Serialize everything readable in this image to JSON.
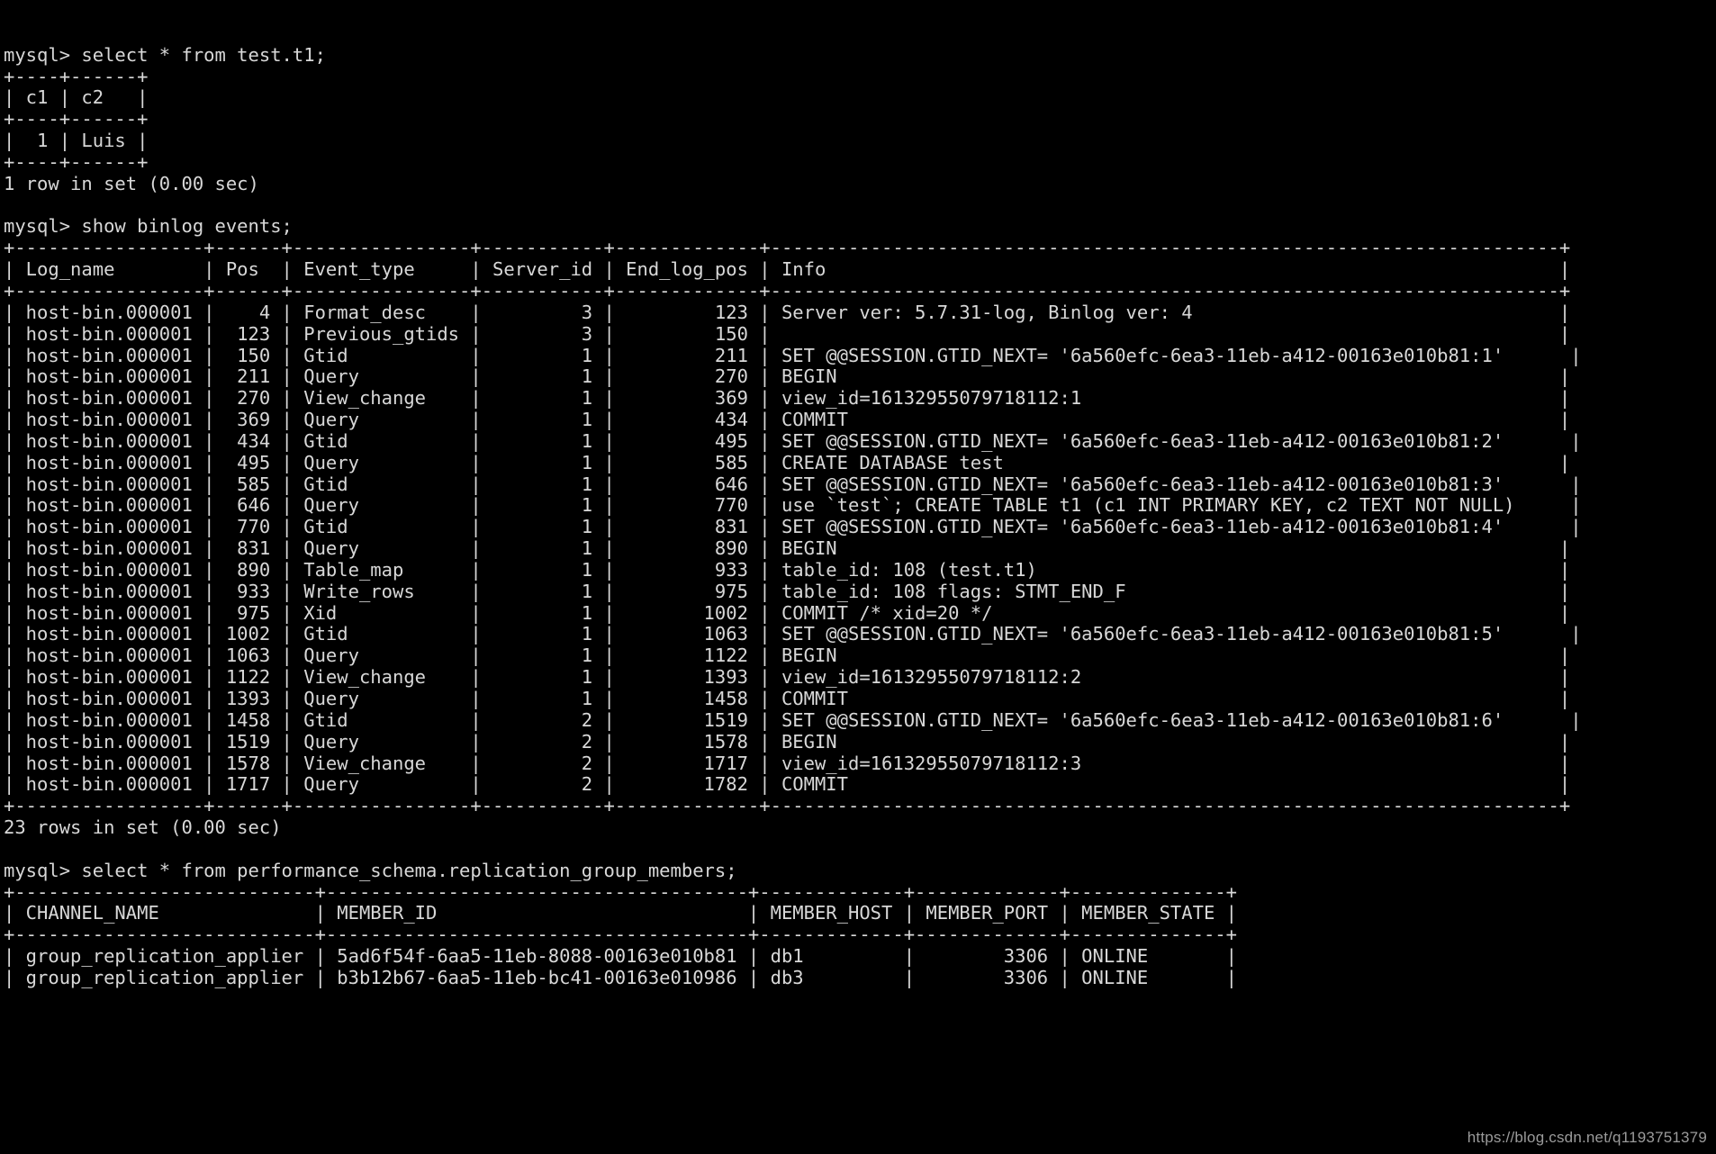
{
  "terminal": {
    "prompt": "mysql> ",
    "watermark": "https://blog.csdn.net/q1193751379",
    "background_color": "#000000",
    "text_color": "#d8d8d8"
  },
  "session": {
    "blocks": [
      {
        "command": "mysql> select * from test.t1;",
        "table": {
          "separator": "+----+------+",
          "header": "| c1 | c2   |",
          "rows": [
            "|  1 | Luis |"
          ]
        },
        "result": "1 row in set (0.00 sec)"
      },
      {
        "command": "mysql> show binlog events;",
        "table": {
          "separator": "+---------------+------+----------------+-----------+-------------+-------------------------------------------------------------------------+",
          "header": "| Log_name      | Pos  | Event_type     | Server_id | End_log_pos | Info                                                                    |",
          "rows": [
            "| host-bin.000001 |    4 | Format_desc    |         3 |         123 | Server ver: 5.7.31-log, Binlog ver: 4",
            "| host-bin.000001 |  123 | Previous_gtids |         3 |         150 |"
          ]
        },
        "result": "23 rows in set (0.00 sec)"
      },
      {
        "command": "mysql> select * from performance_schema.replication_group_members;",
        "table": {
          "separator": "+---------------------------+--------------------------------------+-------------+-------------+--------------+",
          "header": "| CHANNEL_NAME              | MEMBER_ID                            | MEMBER_HOST | MEMBER_PORT | MEMBER_STATE |"
        }
      }
    ]
  },
  "binlog_query": {
    "command": "mysql> show binlog events;",
    "columns": [
      "Log_name",
      "Pos",
      "Event_type",
      "Server_id",
      "End_log_pos",
      "Info"
    ],
    "rows": [
      [
        "host-bin.000001",
        "4",
        "Format_desc",
        "3",
        "123",
        "Server ver: 5.7.31-log, Binlog ver: 4"
      ],
      [
        "host-bin.000001",
        "123",
        "Previous_gtids",
        "3",
        "150",
        ""
      ],
      [
        "host-bin.000001",
        "150",
        "Gtid",
        "1",
        "211",
        "SET @@SESSION.GTID_NEXT= '6a560efc-6ea3-11eb-a412-00163e010b81:1'"
      ],
      [
        "host-bin.000001",
        "211",
        "Query",
        "1",
        "270",
        "BEGIN"
      ],
      [
        "host-bin.000001",
        "270",
        "View_change",
        "1",
        "369",
        "view_id=16132955079718112:1"
      ],
      [
        "host-bin.000001",
        "369",
        "Query",
        "1",
        "434",
        "COMMIT"
      ],
      [
        "host-bin.000001",
        "434",
        "Gtid",
        "1",
        "495",
        "SET @@SESSION.GTID_NEXT= '6a560efc-6ea3-11eb-a412-00163e010b81:2'"
      ],
      [
        "host-bin.000001",
        "495",
        "Query",
        "1",
        "585",
        "CREATE DATABASE test"
      ],
      [
        "host-bin.000001",
        "585",
        "Gtid",
        "1",
        "646",
        "SET @@SESSION.GTID_NEXT= '6a560efc-6ea3-11eb-a412-00163e010b81:3'"
      ],
      [
        "host-bin.000001",
        "646",
        "Query",
        "1",
        "770",
        "use `test`; CREATE TABLE t1 (c1 INT PRIMARY KEY, c2 TEXT NOT NULL)"
      ],
      [
        "host-bin.000001",
        "770",
        "Gtid",
        "1",
        "831",
        "SET @@SESSION.GTID_NEXT= '6a560efc-6ea3-11eb-a412-00163e010b81:4'"
      ],
      [
        "host-bin.000001",
        "831",
        "Query",
        "1",
        "890",
        "BEGIN"
      ],
      [
        "host-bin.000001",
        "890",
        "Table_map",
        "1",
        "933",
        "table_id: 108 (test.t1)"
      ],
      [
        "host-bin.000001",
        "933",
        "Write_rows",
        "1",
        "975",
        "table_id: 108 flags: STMT_END_F"
      ],
      [
        "host-bin.000001",
        "975",
        "Xid",
        "1",
        "1002",
        "COMMIT /* xid=20 */"
      ],
      [
        "host-bin.000001",
        "1002",
        "Gtid",
        "1",
        "1063",
        "SET @@SESSION.GTID_NEXT= '6a560efc-6ea3-11eb-a412-00163e010b81:5'"
      ],
      [
        "host-bin.000001",
        "1063",
        "Query",
        "1",
        "1122",
        "BEGIN"
      ],
      [
        "host-bin.000001",
        "1122",
        "View_change",
        "1",
        "1393",
        "view_id=16132955079718112:2"
      ],
      [
        "host-bin.000001",
        "1393",
        "Query",
        "1",
        "1458",
        "COMMIT"
      ],
      [
        "host-bin.000001",
        "1458",
        "Gtid",
        "2",
        "1519",
        "SET @@SESSION.GTID_NEXT= '6a560efc-6ea3-11eb-a412-00163e010b81:6'"
      ],
      [
        "host-bin.000001",
        "1519",
        "Query",
        "2",
        "1578",
        "BEGIN"
      ],
      [
        "host-bin.000001",
        "1578",
        "View_change",
        "2",
        "1717",
        "view_id=16132955079718112:3"
      ],
      [
        "host-bin.000001",
        "1717",
        "Query",
        "2",
        "1782",
        "COMMIT"
      ]
    ],
    "result": "23 rows in set (0.00 sec)"
  },
  "select_t1": {
    "command": "mysql> select * from test.t1;",
    "columns": [
      "c1",
      "c2"
    ],
    "rows": [
      [
        "1",
        "Luis"
      ]
    ],
    "result": "1 row in set (0.00 sec)"
  },
  "members_query": {
    "command": "mysql> select * from performance_schema.replication_group_members;",
    "columns": [
      "CHANNEL_NAME",
      "MEMBER_ID",
      "MEMBER_HOST",
      "MEMBER_PORT",
      "MEMBER_STATE"
    ],
    "rows": [
      [
        "group_replication_applier",
        "5ad6f54f-6aa5-11eb-8088-00163e010b81",
        "db1",
        "3306",
        "ONLINE"
      ],
      [
        "group_replication_applier",
        "b3b12b67-6aa5-11eb-bc41-00163e010986",
        "db3",
        "3306",
        "ONLINE"
      ]
    ]
  },
  "rendered_lines": [
    "mysql> select * from test.t1;",
    "+----+------+",
    "| c1 | c2   |",
    "+----+------+",
    "|  1 | Luis |",
    "+----+------+",
    "1 row in set (0.00 sec)",
    "",
    "mysql> show binlog events;",
    "+-----------------+------+----------------+-----------+-------------+-----------------------------------------------------------------------+",
    "| Log_name        | Pos  | Event_type     | Server_id | End_log_pos | Info                                                                  |",
    "+-----------------+------+----------------+-----------+-------------+-----------------------------------------------------------------------+",
    "| host-bin.000001 |    4 | Format_desc    |         3 |         123 | Server ver: 5.7.31-log, Binlog ver: 4                                 |",
    "| host-bin.000001 |  123 | Previous_gtids |         3 |         150 |                                                                       |",
    "| host-bin.000001 |  150 | Gtid           |         1 |         211 | SET @@SESSION.GTID_NEXT= '6a560efc-6ea3-11eb-a412-00163e010b81:1'      |",
    "| host-bin.000001 |  211 | Query          |         1 |         270 | BEGIN                                                                 |",
    "| host-bin.000001 |  270 | View_change    |         1 |         369 | view_id=16132955079718112:1                                           |",
    "| host-bin.000001 |  369 | Query          |         1 |         434 | COMMIT                                                                |",
    "| host-bin.000001 |  434 | Gtid           |         1 |         495 | SET @@SESSION.GTID_NEXT= '6a560efc-6ea3-11eb-a412-00163e010b81:2'      |",
    "| host-bin.000001 |  495 | Query          |         1 |         585 | CREATE DATABASE test                                                  |",
    "| host-bin.000001 |  585 | Gtid           |         1 |         646 | SET @@SESSION.GTID_NEXT= '6a560efc-6ea3-11eb-a412-00163e010b81:3'      |",
    "| host-bin.000001 |  646 | Query          |         1 |         770 | use `test`; CREATE TABLE t1 (c1 INT PRIMARY KEY, c2 TEXT NOT NULL)     |",
    "| host-bin.000001 |  770 | Gtid           |         1 |         831 | SET @@SESSION.GTID_NEXT= '6a560efc-6ea3-11eb-a412-00163e010b81:4'      |",
    "| host-bin.000001 |  831 | Query          |         1 |         890 | BEGIN                                                                 |",
    "| host-bin.000001 |  890 | Table_map      |         1 |         933 | table_id: 108 (test.t1)                                               |",
    "| host-bin.000001 |  933 | Write_rows     |         1 |         975 | table_id: 108 flags: STMT_END_F                                       |",
    "| host-bin.000001 |  975 | Xid            |         1 |        1002 | COMMIT /* xid=20 */                                                   |",
    "| host-bin.000001 | 1002 | Gtid           |         1 |        1063 | SET @@SESSION.GTID_NEXT= '6a560efc-6ea3-11eb-a412-00163e010b81:5'      |",
    "| host-bin.000001 | 1063 | Query          |         1 |        1122 | BEGIN                                                                 |",
    "| host-bin.000001 | 1122 | View_change    |         1 |        1393 | view_id=16132955079718112:2                                           |",
    "| host-bin.000001 | 1393 | Query          |         1 |        1458 | COMMIT                                                                |",
    "| host-bin.000001 | 1458 | Gtid           |         2 |        1519 | SET @@SESSION.GTID_NEXT= '6a560efc-6ea3-11eb-a412-00163e010b81:6'      |",
    "| host-bin.000001 | 1519 | Query          |         2 |        1578 | BEGIN                                                                 |",
    "| host-bin.000001 | 1578 | View_change    |         2 |        1717 | view_id=16132955079718112:3                                           |",
    "| host-bin.000001 | 1717 | Query          |         2 |        1782 | COMMIT                                                                |",
    "+-----------------+------+----------------+-----------+-------------+-----------------------------------------------------------------------+",
    "23 rows in set (0.00 sec)",
    "",
    "mysql> select * from performance_schema.replication_group_members;",
    "+---------------------------+--------------------------------------+-------------+-------------+--------------+",
    "| CHANNEL_NAME              | MEMBER_ID                            | MEMBER_HOST | MEMBER_PORT | MEMBER_STATE |",
    "+---------------------------+--------------------------------------+-------------+-------------+--------------+",
    "| group_replication_applier | 5ad6f54f-6aa5-11eb-8088-00163e010b81 | db1         |        3306 | ONLINE       |",
    "| group_replication_applier | b3b12b67-6aa5-11eb-bc41-00163e010986 | db3         |        3306 | ONLINE       |"
  ]
}
